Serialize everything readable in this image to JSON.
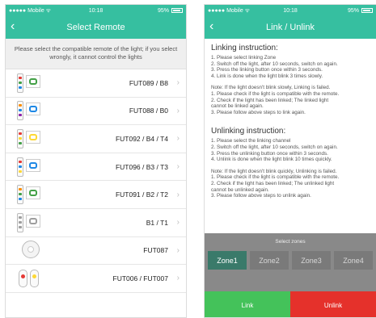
{
  "left": {
    "status": {
      "carrier": "●●●●● Mobile ᯤ",
      "time": "10:18",
      "battery": "95%"
    },
    "title": "Select Remote",
    "notice": "Please select the compatible remote of the light; if you select wrongly, it cannot control the lights",
    "remotes": [
      {
        "label": "FUT089 / B8"
      },
      {
        "label": "FUT088 / B0"
      },
      {
        "label": "FUT092 / B4 / T4"
      },
      {
        "label": "FUT096 / B3 / T3"
      },
      {
        "label": "FUT091 / B2 / T2"
      },
      {
        "label": "B1 / T1"
      },
      {
        "label": "FUT087"
      },
      {
        "label": "FUT006 / FUT007"
      }
    ]
  },
  "right": {
    "status": {
      "carrier": "●●●●● Mobile ᯤ",
      "time": "10:18",
      "battery": "95%"
    },
    "title": "Link / Unlink",
    "linking_title": "Linking instruction:",
    "linking_lines": [
      "1. Please select linking Zone",
      "2. Switch off the light, after 10 seconds, switch on again.",
      "3. Press the linking button once within 3 seconds.",
      "4. Link is done when the light blink 3 times slowly."
    ],
    "linking_note": [
      "Note: If the light doesn't blink slowly, Linking is failed.",
      "1. Please check if the light is compatible with the remote.",
      "2. Check if the light has been linked; The linked light",
      "cannot be linked again.",
      "3. Please follow above steps to link again."
    ],
    "unlinking_title": "Unlinking instruction:",
    "unlinking_lines": [
      "1. Please select the linking channel",
      "2. Switch off the light, after 10 seconds, switch on again.",
      "3. Press the unlinking button once within 3 seconds.",
      "4. Unlink is done when the light blink 10 times quickly."
    ],
    "unlinking_note": [
      "Note:  If the light doesn't blink quickly, Unlinking is failed.",
      "1. Please check if the light is compatible with the remote.",
      "2. Check if the light has been linked; The unlinked light",
      "cannot be unlinked again.",
      "3. Please follow above steps to unlink again."
    ],
    "zones_title": "Select zones",
    "zones": [
      "Zone1",
      "Zone2",
      "Zone3",
      "Zone4"
    ],
    "active_zone": 0,
    "link_label": "Link",
    "unlink_label": "Unlink"
  },
  "colors": {
    "accent": "#36bfa0",
    "link": "#44c25a",
    "unlink": "#e5312b",
    "zone_active": "#3a7a6a"
  },
  "icons": {
    "back": "chevron-left-icon",
    "row": "chevron-right-icon",
    "battery": "battery-icon",
    "wifi": "wifi-icon"
  }
}
